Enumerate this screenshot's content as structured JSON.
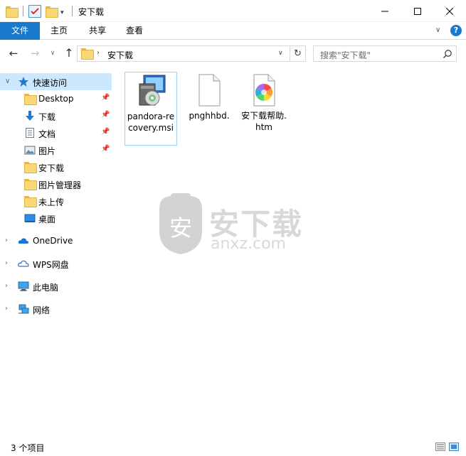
{
  "window": {
    "title": "安下载"
  },
  "ribbon": {
    "tabs": [
      "文件",
      "主页",
      "共享",
      "查看"
    ]
  },
  "address": {
    "path": "安下载",
    "search_placeholder": "搜索\"安下载\""
  },
  "sidebar": {
    "quick_access": "快速访问",
    "pinned": [
      "Desktop",
      "下载",
      "文档",
      "图片"
    ],
    "folders": [
      "安下载",
      "图片管理器",
      "未上传"
    ],
    "desktop": "桌面",
    "locations": [
      "OneDrive",
      "WPS网盘",
      "此电脑",
      "网络"
    ]
  },
  "files": [
    {
      "name": "pandora-recovery.msi",
      "icon": "msi-installer-icon"
    },
    {
      "name": "pnghhbd.",
      "icon": "blank-file-icon"
    },
    {
      "name": "安下载帮助.htm",
      "icon": "htm-file-icon"
    }
  ],
  "watermark": {
    "text": "安下载",
    "sub": "anxz.com",
    "badge": "安"
  },
  "status": {
    "item_count": "3 个项目"
  }
}
